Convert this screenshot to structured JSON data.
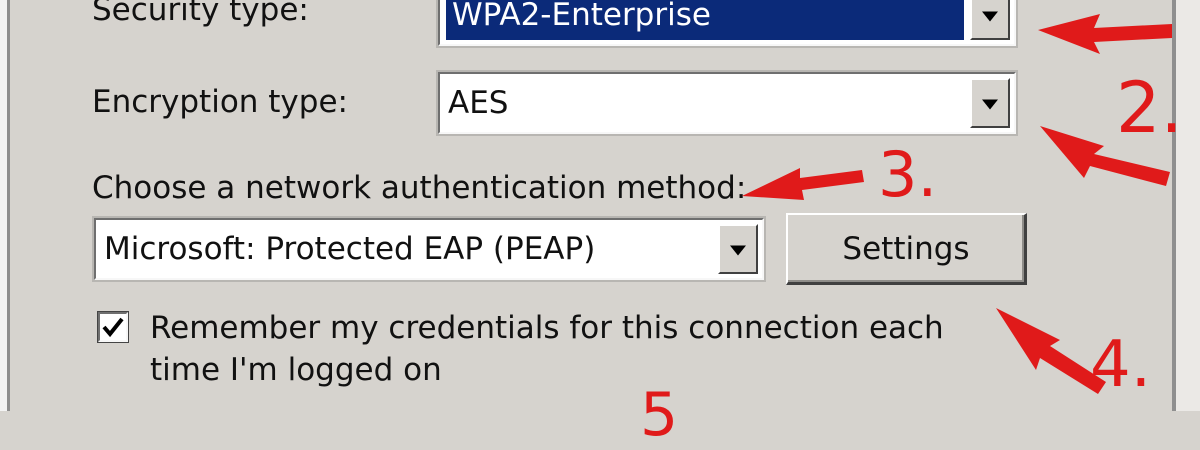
{
  "form": {
    "security_label": "Security type:",
    "security_value": "WPA2-Enterprise",
    "encryption_label": "Encryption type:",
    "encryption_value": "AES",
    "auth_label": "Choose a network authentication method:",
    "auth_value": "Microsoft: Protected EAP (PEAP)",
    "settings_button": "Settings",
    "remember_line1": "Remember my credentials for this connection each",
    "remember_line2": "time I'm logged on",
    "remember_checked": true
  },
  "annotations": {
    "step2": "2.",
    "step3": "3.",
    "step4": "4.",
    "step5": "5",
    "color": "#e01a1a"
  }
}
